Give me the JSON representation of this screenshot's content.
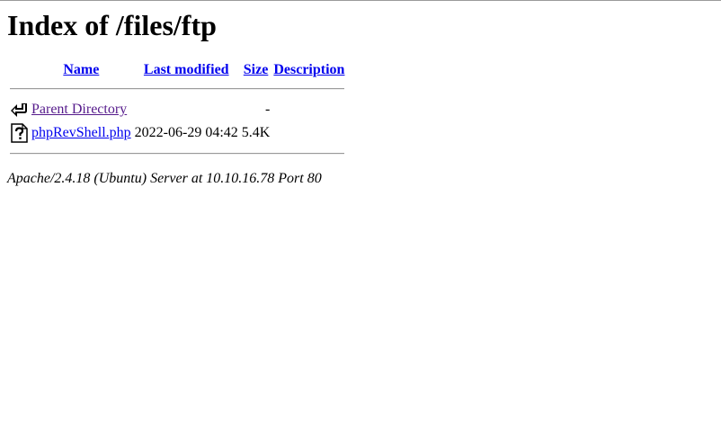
{
  "page": {
    "title": "Index of /files/ftp"
  },
  "table": {
    "headers": {
      "name": "Name",
      "last_modified": "Last modified",
      "size": "Size",
      "description": "Description"
    },
    "rows": [
      {
        "icon": "back-arrow-icon",
        "name": "Parent Directory",
        "last_modified": "",
        "size": "-",
        "description": ""
      },
      {
        "icon": "unknown-file-icon",
        "name": "phpRevShell.php",
        "last_modified": "2022-06-29 04:42",
        "size": "5.4K",
        "description": ""
      }
    ]
  },
  "footer": {
    "address": "Apache/2.4.18 (Ubuntu) Server at 10.10.16.78 Port 80"
  },
  "colors": {
    "link": "#0000ee",
    "visited_link": "#551a8b",
    "rule": "#9a9a9a"
  }
}
